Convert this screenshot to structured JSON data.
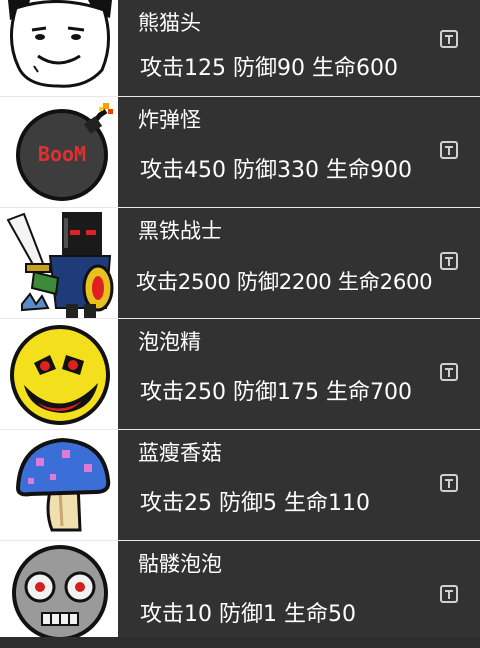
{
  "monsters": [
    {
      "name": "熊猫头",
      "stats": "攻击125 防御90 生命600",
      "icon": "panda-head-meme-icon"
    },
    {
      "name": "炸弹怪",
      "stats": "攻击450 防御330 生命900",
      "icon": "bomb-monster-icon",
      "bomb_text": "BooM"
    },
    {
      "name": "黑铁战士",
      "stats": "攻击2500 防御2200 生命2600",
      "icon": "black-iron-warrior-icon"
    },
    {
      "name": "泡泡精",
      "stats": "攻击250 防御175 生命700",
      "icon": "bubble-spirit-icon"
    },
    {
      "name": "蓝瘦香菇",
      "stats": "攻击25 防御5 生命110",
      "icon": "blue-mushroom-icon"
    },
    {
      "name": "骷髅泡泡",
      "stats": "攻击10 防御1 生命50",
      "icon": "skull-bubble-icon"
    }
  ],
  "colors": {
    "row_background": "#323232",
    "avatar_background": "#ffffff",
    "divider": "#e8e8e8",
    "text": "#ffffff",
    "badge": "#d0d0d0"
  },
  "badge_icon": "text-format-icon"
}
